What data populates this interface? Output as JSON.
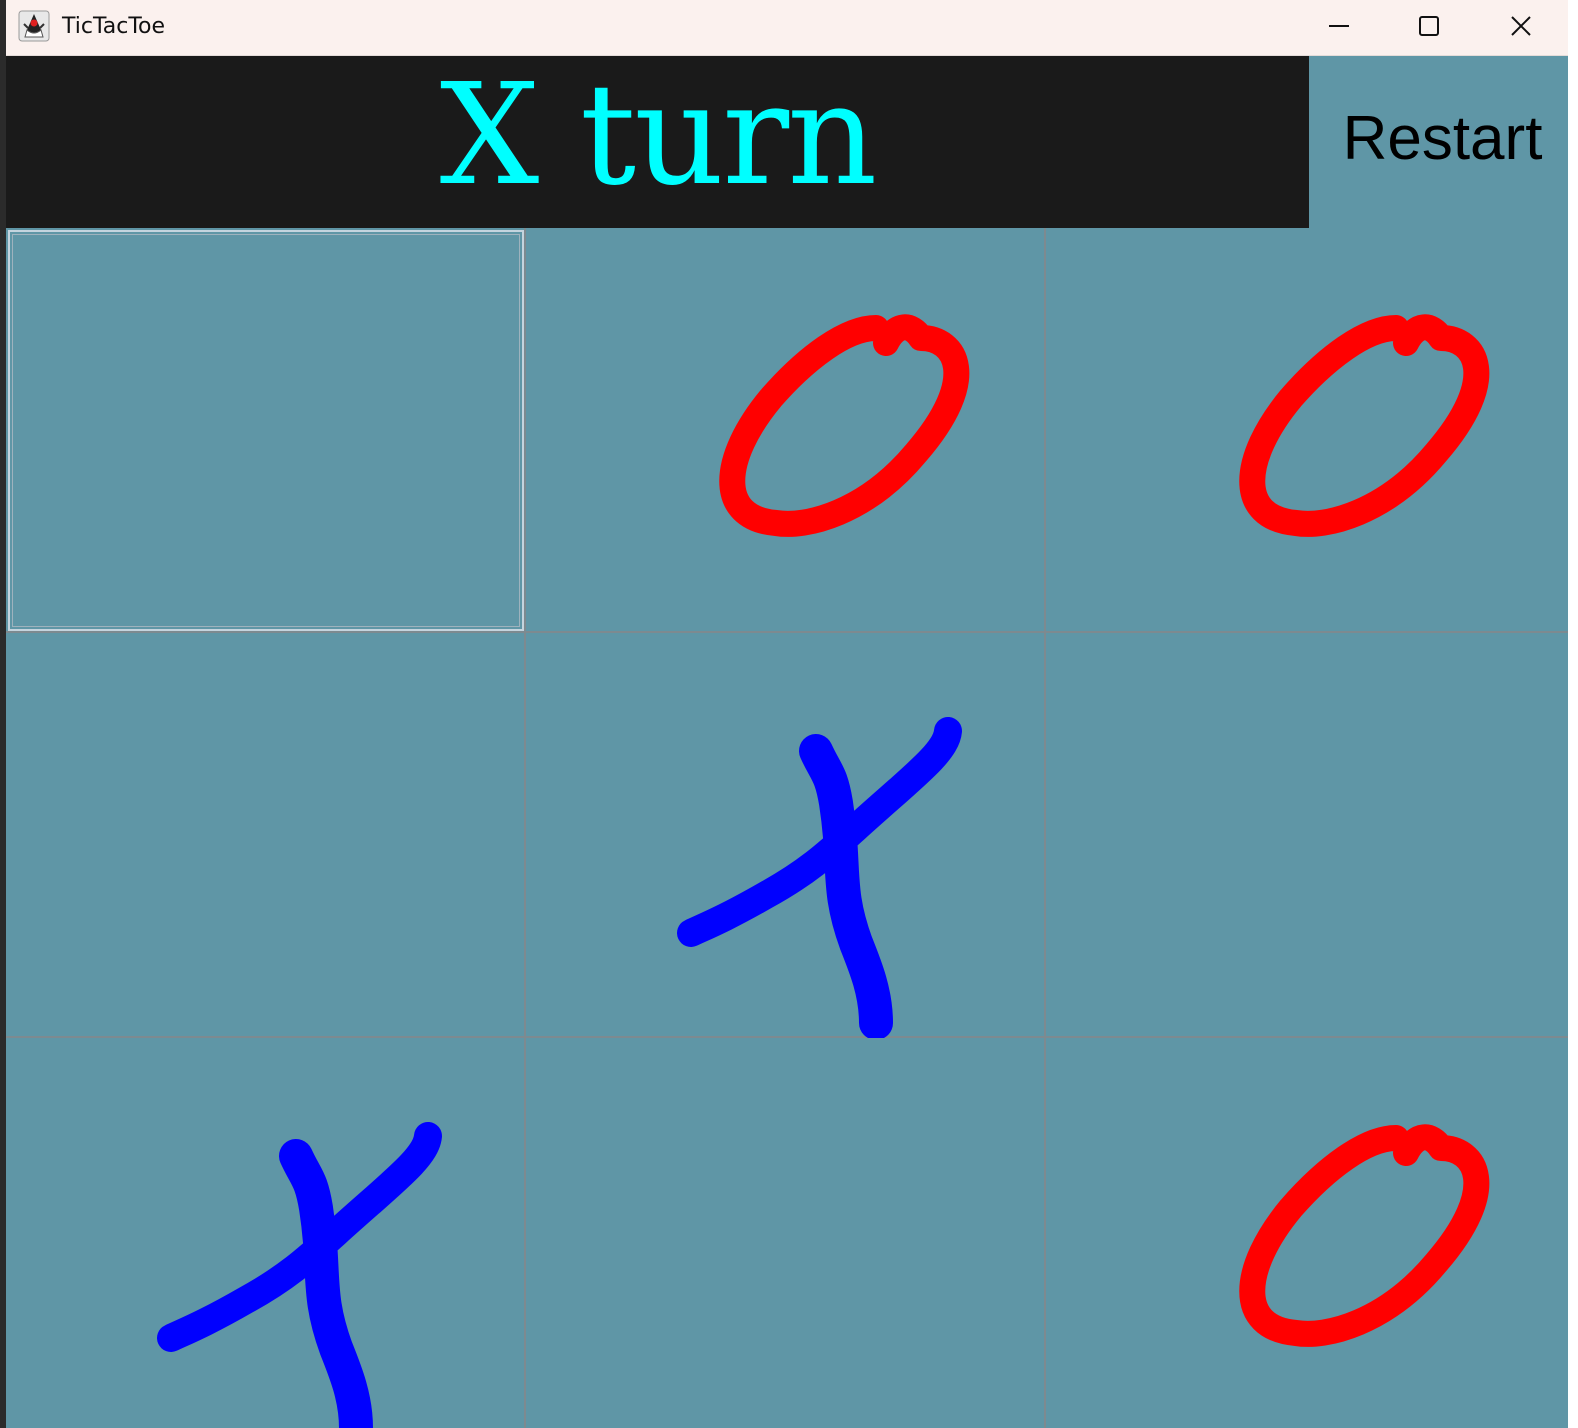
{
  "window": {
    "title": "TicTacToe",
    "app_icon": "java-duke-icon",
    "controls": [
      "minimize-icon",
      "maximize-icon",
      "close-icon"
    ]
  },
  "header": {
    "status_text": "X turn",
    "status_color": "#00ffff",
    "status_background": "#1a1a1a",
    "restart_label": "Restart"
  },
  "board": {
    "background": "#5f96a6",
    "x_color": "#0000ff",
    "o_color": "#ff0000",
    "focused_cell": 0,
    "cells": [
      "",
      "O",
      "O",
      "",
      "X",
      "",
      "X",
      "",
      "O"
    ]
  }
}
